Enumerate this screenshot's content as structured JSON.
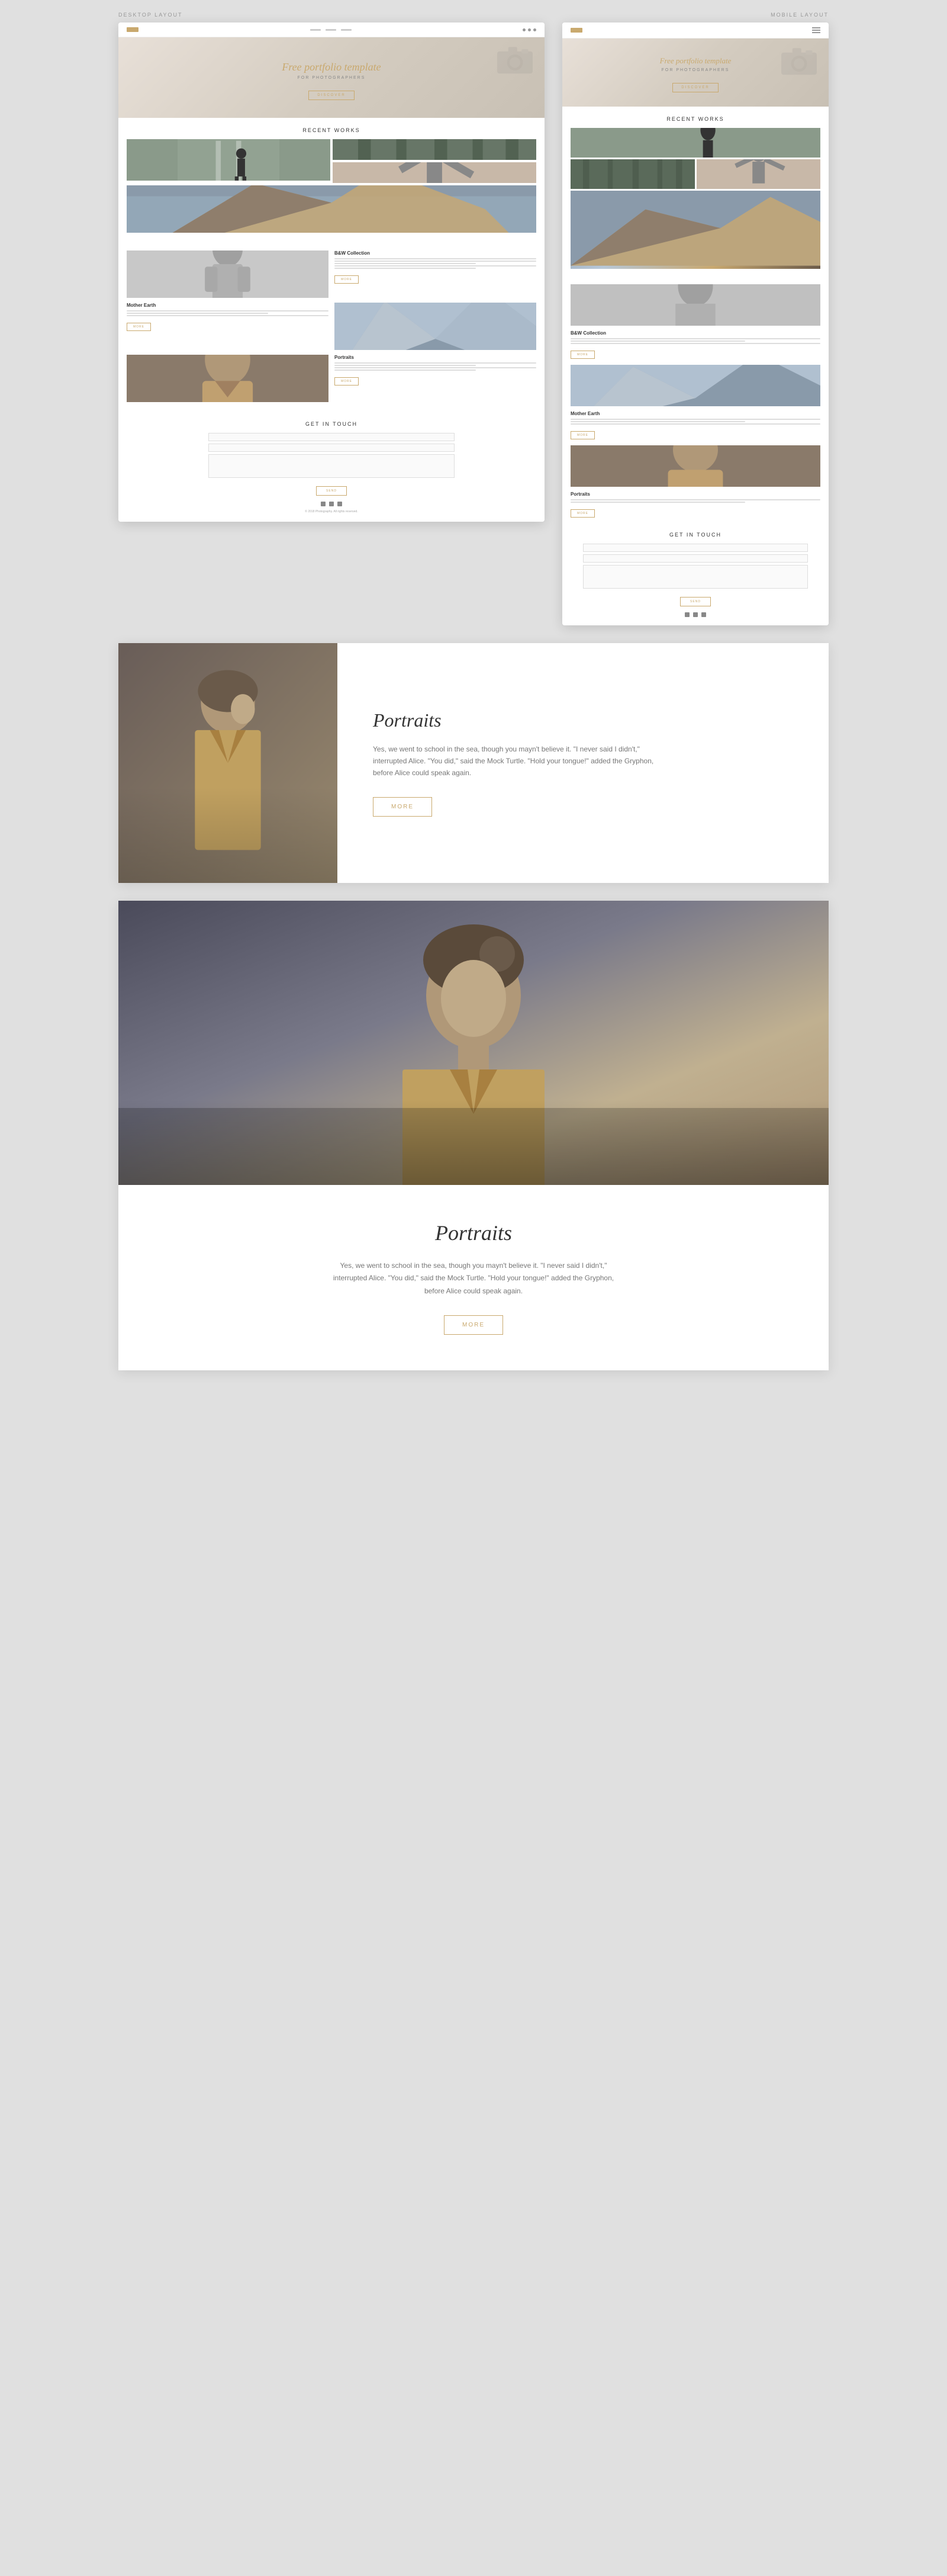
{
  "layouts": {
    "desktop_label": "DESKTOP LAYOUT",
    "mobile_label": "MOBILE LAYOUT"
  },
  "nav": {
    "home": "Home",
    "gallery": "Gallery",
    "contact": "Contact"
  },
  "hero": {
    "title": "Free portfolio template",
    "subtitle": "for photographers",
    "discover_btn": "DISCOVER"
  },
  "recent_works": {
    "section_title": "Recent works"
  },
  "bw_collection": {
    "title": "B&W Collection",
    "description": "The series started to produce book-sized posters with the theme of Experimental Art and the Art of the street and the course of this in modern culture literature",
    "more_btn": "MORE"
  },
  "mother_earth": {
    "title": "Mother Earth",
    "description": "You can be as short as we know and have the ability and strength as strength as the Mother Earth alone",
    "more_btn": "MORE"
  },
  "portraits_section": {
    "title": "Portraits",
    "description": "Yes, we went to school in the sea, though you mayn't believe it. \"I never said I didn't,\" interrupted Alice. \"You did,\" said the Mock Turtle. \"Hold your tongue!\" added the Gryphon, before Alice could speak again.",
    "more_btn": "MORE"
  },
  "contact": {
    "title": "Get in touch",
    "name_placeholder": "Your name",
    "email_placeholder": "Email",
    "message_placeholder": "Message",
    "send_btn": "SEND"
  },
  "footer": {
    "copyright": "© 2018 Photography. All rights reserved."
  },
  "portraits_large": {
    "title": "Portraits",
    "description": "Yes, we went to school in the sea, though you mayn't believe it. \"I never said I didn't,\" interrupted Alice. \"You did,\" said the Mock Turtle. \"Hold your tongue!\" added the Gryphon, before Alice could speak again.",
    "more_btn": "MORE"
  },
  "mother_large": {
    "title": "Portraits",
    "description": "Yes, we went to school in the sea, though you mayn't believe it. \"I never said I didn't,\" interrupted Alice. \"You did,\" said the Mock Turtle. \"Hold your tongue!\" added the Gryphon, before Alice could speak again.",
    "more_btn": "MORE"
  },
  "colors": {
    "gold": "#c9a96e",
    "dark": "#333",
    "mid": "#777",
    "light": "#ddd"
  }
}
